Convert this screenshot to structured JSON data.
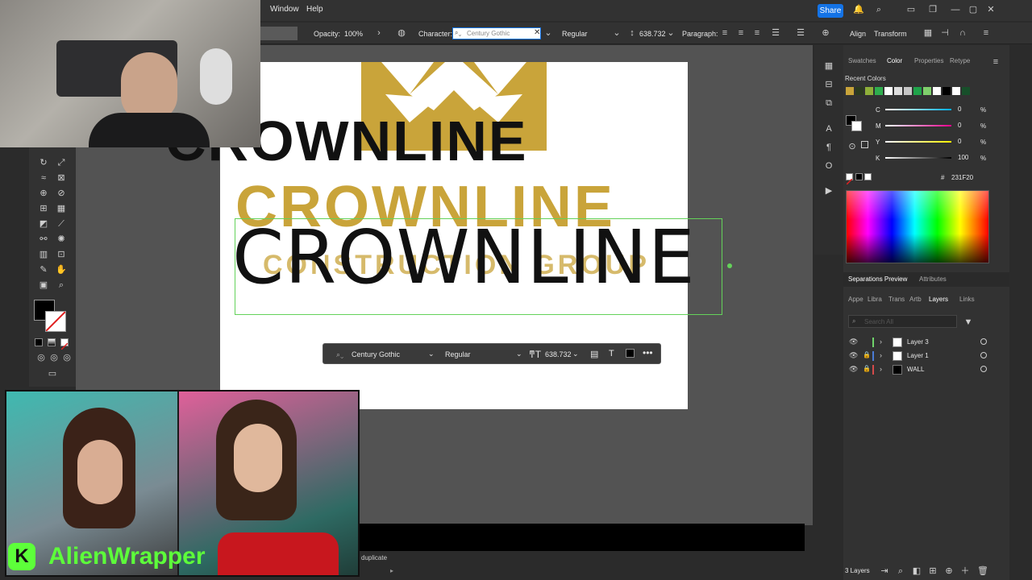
{
  "menubar": {
    "items": [
      "Window",
      "Help"
    ],
    "share_label": "Share"
  },
  "control_bar": {
    "opacity_label": "Opacity:",
    "opacity_value": "100%",
    "character_label": "Character:",
    "font_value": "Century Gothic",
    "style_value": "Regular",
    "size_value": "638.732",
    "paragraph_label": "Paragraph:",
    "align_label": "Align",
    "transform_label": "Transform"
  },
  "artboard": {
    "text_top": "CROWNLINE",
    "text_gold": "CROWNLINE",
    "text_sub": "CONSTRUCTION GROUP",
    "text_thin": "CROWNLINE"
  },
  "context_bar": {
    "font_value": "Century Gothic",
    "style_value": "Regular",
    "size_value": "638.732"
  },
  "color_panel": {
    "tabs": [
      "Swatches",
      "Color",
      "Properties",
      "Retype"
    ],
    "active_tab": "Color",
    "recent_colors_label": "Recent Colors",
    "recent_colors": [
      "#c9a43a",
      "#2b3a1f",
      "#8fb03a",
      "#2fae4e",
      "#ffffff",
      "#dddddd",
      "#c6c6c6",
      "#1fa34a",
      "#7fcf6c",
      "#ffffff",
      "#000000",
      "#ffffff",
      "#174f2a"
    ],
    "cmyk": [
      {
        "label": "C",
        "value": "0"
      },
      {
        "label": "M",
        "value": "0"
      },
      {
        "label": "Y",
        "value": "0"
      },
      {
        "label": "K",
        "value": "100"
      }
    ],
    "percent": "%",
    "hex_value": "231F20"
  },
  "lower_panel": {
    "tabs1": [
      "Separations Preview",
      "Attributes"
    ],
    "tabs2": [
      "Appe",
      "Libra",
      "Trans",
      "Artb",
      "Layers",
      "Links"
    ],
    "search_placeholder": "Search All",
    "layers": [
      {
        "name": "Layer 3",
        "color": "#6fd46a"
      },
      {
        "name": "Layer 1",
        "color": "#4a7bd4"
      },
      {
        "name": "WALL",
        "color": "#d44a4a"
      }
    ],
    "footer": "3 Layers"
  },
  "status": {
    "tooltip": "duplicate"
  },
  "overlay": {
    "watermark": "AlienWrapper"
  }
}
